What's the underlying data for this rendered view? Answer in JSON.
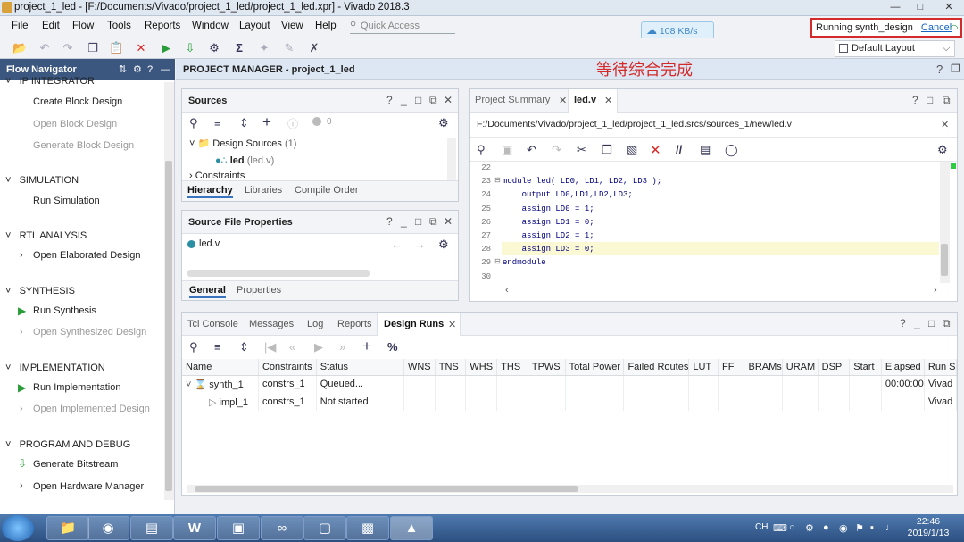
{
  "window": {
    "title": "project_1_led - [F:/Documents/Vivado/project_1_led/project_1_led.xpr] - Vivado 2018.3"
  },
  "menu": [
    "File",
    "Edit",
    "Flow",
    "Tools",
    "Reports",
    "Window",
    "Layout",
    "View",
    "Help"
  ],
  "quick_access": {
    "placeholder": "Quick Access"
  },
  "speed_badge": "108 KB/s",
  "status": {
    "running": "Running synth_design",
    "cancel": "Cancel"
  },
  "layout_select": "Default Layout",
  "flow_navigator": {
    "title": "Flow Navigator",
    "sections": [
      {
        "label": "IP INTEGRATOR",
        "items": [
          {
            "label": "Create Block Design",
            "enabled": true
          },
          {
            "label": "Open Block Design",
            "enabled": false
          },
          {
            "label": "Generate Block Design",
            "enabled": false
          }
        ]
      },
      {
        "label": "SIMULATION",
        "items": [
          {
            "label": "Run Simulation",
            "enabled": true
          }
        ]
      },
      {
        "label": "RTL ANALYSIS",
        "items": [
          {
            "label": "Open Elaborated Design",
            "enabled": true
          }
        ]
      },
      {
        "label": "SYNTHESIS",
        "items": [
          {
            "label": "Run Synthesis",
            "enabled": true
          },
          {
            "label": "Open Synthesized Design",
            "enabled": false
          }
        ]
      },
      {
        "label": "IMPLEMENTATION",
        "items": [
          {
            "label": "Run Implementation",
            "enabled": true
          },
          {
            "label": "Open Implemented Design",
            "enabled": false
          }
        ]
      },
      {
        "label": "PROGRAM AND DEBUG",
        "items": [
          {
            "label": "Generate Bitstream",
            "enabled": true
          },
          {
            "label": "Open Hardware Manager",
            "enabled": true
          }
        ]
      }
    ]
  },
  "project_manager": {
    "title": "PROJECT MANAGER - project_1_led"
  },
  "annotation": "等待综合完成",
  "sources": {
    "title": "Sources",
    "count_badge": "0",
    "tree": [
      {
        "label": "Design Sources",
        "count": "(1)"
      },
      {
        "label": "led",
        "sub": "(led.v)"
      },
      {
        "label": "Constraints"
      }
    ],
    "tabs": [
      "Hierarchy",
      "Libraries",
      "Compile Order"
    ]
  },
  "source_props": {
    "title": "Source File Properties",
    "file": "led.v",
    "tabs": [
      "General",
      "Properties"
    ]
  },
  "editor": {
    "tabs": [
      "Project Summary",
      "led.v"
    ],
    "path": "F:/Documents/Vivado/project_1_led/project_1_led.srcs/sources_1/new/led.v",
    "lines": [
      {
        "n": "22",
        "text": ""
      },
      {
        "n": "23",
        "text": "module led( LD0, LD1, LD2, LD3 );"
      },
      {
        "n": "24",
        "text": "    output LD0,LD1,LD2,LD3;"
      },
      {
        "n": "25",
        "text": "    assign LD0 = 1;"
      },
      {
        "n": "26",
        "text": "    assign LD1 = 0;"
      },
      {
        "n": "27",
        "text": "    assign LD2 = 1;"
      },
      {
        "n": "28",
        "text": "    assign LD3 = 0;"
      },
      {
        "n": "29",
        "text": "endmodule"
      },
      {
        "n": "30",
        "text": ""
      }
    ]
  },
  "runs_panel": {
    "tabs": [
      "Tcl Console",
      "Messages",
      "Log",
      "Reports",
      "Design Runs"
    ],
    "columns": [
      "Name",
      "Constraints",
      "Status",
      "WNS",
      "TNS",
      "WHS",
      "THS",
      "TPWS",
      "Total Power",
      "Failed Routes",
      "LUT",
      "FF",
      "BRAMs",
      "URAM",
      "DSP",
      "Start",
      "Elapsed",
      "Run S"
    ],
    "rows": [
      {
        "name": "synth_1",
        "constraints": "constrs_1",
        "status": "Queued...",
        "elapsed": "00:00:00",
        "run": "Vivad"
      },
      {
        "name": "impl_1",
        "constraints": "constrs_1",
        "status": "Not started",
        "elapsed": "",
        "run": "Vivad"
      }
    ]
  },
  "taskbar": {
    "lang": "CH",
    "time": "22:46",
    "date": "2019/1/13"
  }
}
